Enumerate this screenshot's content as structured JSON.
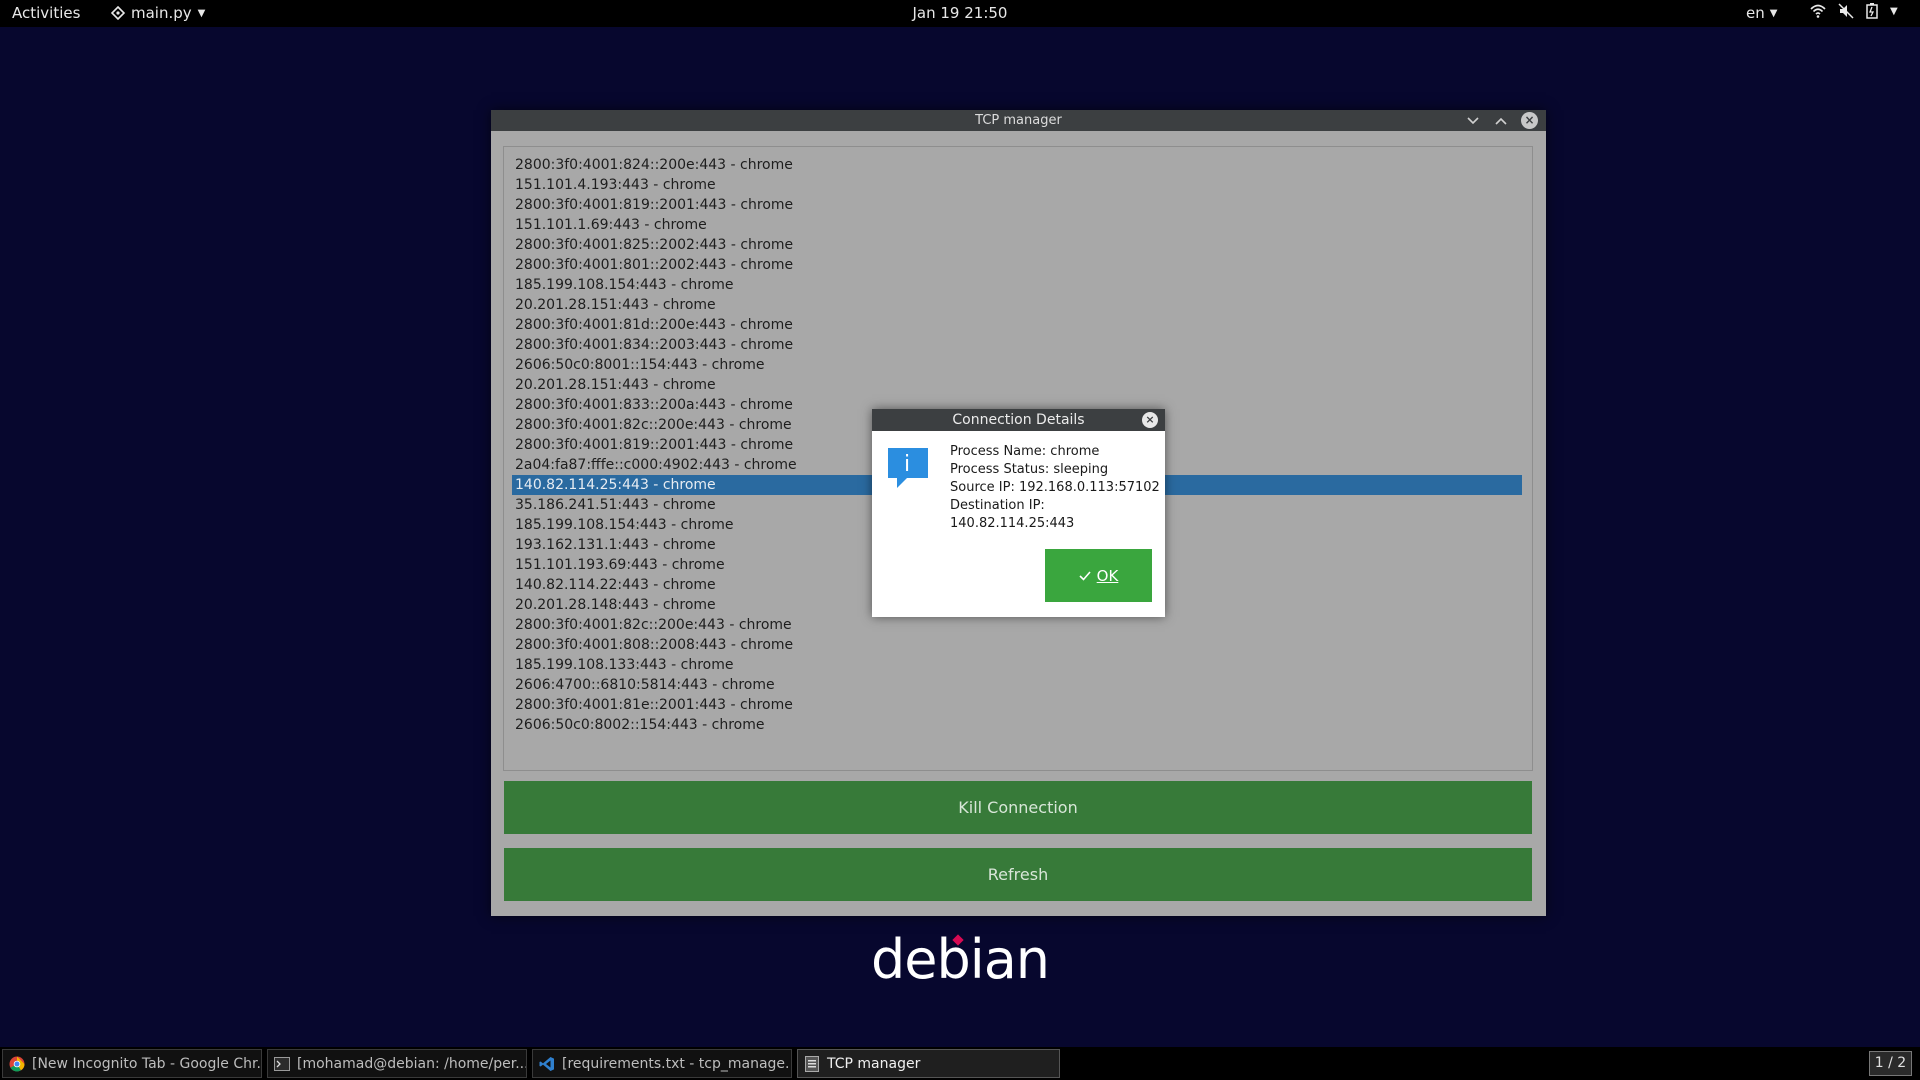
{
  "topbar": {
    "activities": "Activities",
    "app_menu": "main.py",
    "clock": "Jan 19  21:50",
    "lang": "en"
  },
  "window": {
    "title": "TCP manager",
    "connections": [
      "2800:3f0:4001:824::200e:443 - chrome",
      "151.101.4.193:443 - chrome",
      "2800:3f0:4001:819::2001:443 - chrome",
      "151.101.1.69:443 - chrome",
      "2800:3f0:4001:825::2002:443 - chrome",
      "2800:3f0:4001:801::2002:443 - chrome",
      "185.199.108.154:443 - chrome",
      "20.201.28.151:443 - chrome",
      "2800:3f0:4001:81d::200e:443 - chrome",
      "2800:3f0:4001:834::2003:443 - chrome",
      "2606:50c0:8001::154:443 - chrome",
      "20.201.28.151:443 - chrome",
      "2800:3f0:4001:833::200a:443 - chrome",
      "2800:3f0:4001:82c::200e:443 - chrome",
      "2800:3f0:4001:819::2001:443 - chrome",
      "2a04:fa87:fffe::c000:4902:443 - chrome",
      "140.82.114.25:443 - chrome",
      "35.186.241.51:443 - chrome",
      "185.199.108.154:443 - chrome",
      "193.162.131.1:443 - chrome",
      "151.101.193.69:443 - chrome",
      "140.82.114.22:443 - chrome",
      "20.201.28.148:443 - chrome",
      "2800:3f0:4001:82c::200e:443 - chrome",
      "2800:3f0:4001:808::2008:443 - chrome",
      "185.199.108.133:443 - chrome",
      "2606:4700::6810:5814:443 - chrome",
      "2800:3f0:4001:81e::2001:443 - chrome",
      "2606:50c0:8002::154:443 - chrome"
    ],
    "selected_index": 16,
    "kill_label": "Kill Connection",
    "refresh_label": "Refresh"
  },
  "dialog": {
    "title": "Connection Details",
    "process_name": "Process Name: chrome",
    "process_status": "Process Status: sleeping",
    "source_ip": "Source IP: 192.168.0.113:57102",
    "destination_ip": "Destination IP: 140.82.114.25:443",
    "ok_label": "OK"
  },
  "desktop": {
    "logo_text": "debian"
  },
  "taskbar": {
    "items": [
      {
        "label": "[New Incognito Tab - Google Chr...",
        "icon": "chrome-icon"
      },
      {
        "label": "[mohamad@debian: /home/per...",
        "icon": "terminal-icon"
      },
      {
        "label": "[requirements.txt - tcp_manage...",
        "icon": "vscode-icon"
      },
      {
        "label": "TCP manager",
        "icon": "app-window-icon"
      }
    ],
    "workspace": "1 / 2"
  },
  "colors": {
    "desktop_bg": "#07072e",
    "button_green": "#377a39",
    "ok_green": "#3aa63e",
    "selection_blue": "#2a6aa0",
    "debian_red": "#d70a53"
  }
}
